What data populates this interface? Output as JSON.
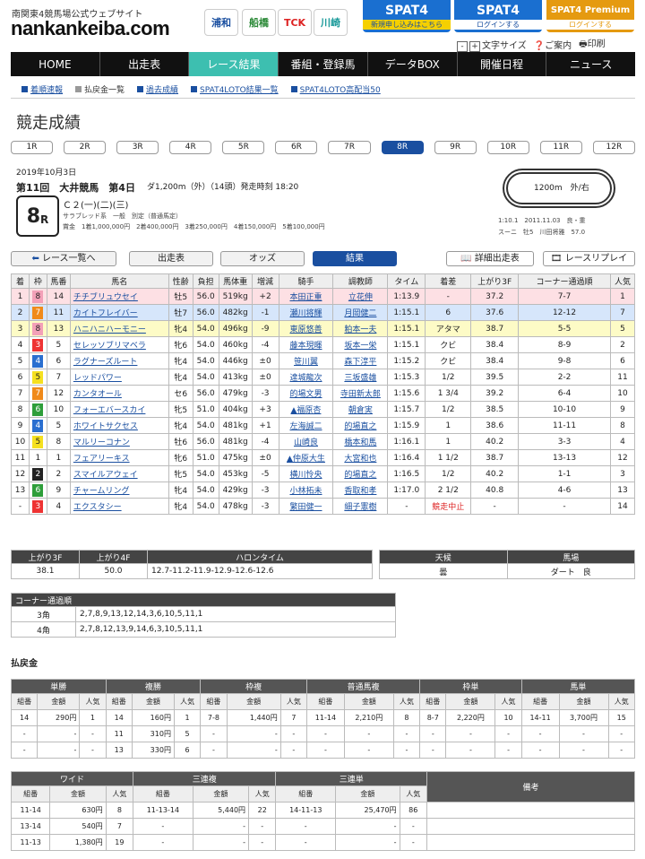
{
  "header": {
    "tagline": "南関東4競馬場公式ウェブサイト",
    "logo": "nankankeiba.com",
    "icons": [
      "浦和",
      "船橋",
      "TCK",
      "川崎"
    ],
    "banners": [
      {
        "big": "SPAT4",
        "sub": "新規申し込みはこちら",
        "color": "#1a6fd0"
      },
      {
        "big": "SPAT4",
        "sub": "ログインする",
        "color": "#1a6fd0"
      },
      {
        "big": "SPAT4 Premium",
        "sub": "ログインする",
        "color": "#e59a10"
      }
    ],
    "toolbar": {
      "font_size": "文字サイズ",
      "guide": "ご案内",
      "print": "印刷"
    }
  },
  "nav": [
    "HOME",
    "出走表",
    "レース結果",
    "番組・登録馬",
    "データBOX",
    "開催日程",
    "ニュース"
  ],
  "nav_active": 2,
  "subnav": [
    {
      "label": "着順速報",
      "link": true
    },
    {
      "label": "払戻金一覧",
      "link": false
    },
    {
      "label": "過去成績",
      "link": true
    },
    {
      "label": "SPAT4LOTO結果一覧",
      "link": true
    },
    {
      "label": "SPAT4LOTO高配当50",
      "link": true
    }
  ],
  "page_title": "競走成績",
  "race_tabs": [
    "1R",
    "2R",
    "3R",
    "4R",
    "5R",
    "6R",
    "7R",
    "8R",
    "9R",
    "10R",
    "11R",
    "12R"
  ],
  "race_active": 7,
  "race": {
    "date": "2019年10月3日",
    "kai": "第11回　大井競馬　第4日",
    "course": "ダ1,200m（外）（14頭）発走時刻 18:20",
    "num": "8",
    "num_suffix": "R",
    "class": "Ｃ２(一)(二)(三)",
    "cond": "サラブレッド系　一般　別定（普通馬定）",
    "prize": "賞金　1着1,000,000円　2着400,000円　3着250,000円　4着150,000円　5着100,000円",
    "track_label": "1200m　外/右",
    "record1": "1:10.1　2011.11.03　良・重",
    "record2": "スーニ　牡5　川田将雅　57.0"
  },
  "buttons": {
    "list": "レース一覧へ",
    "card": "出走表",
    "odds": "オッズ",
    "result": "結果",
    "detail": "詳細出走表",
    "replay": "レースリプレイ"
  },
  "result_headers": [
    "着",
    "枠",
    "馬番",
    "馬名",
    "性齢",
    "負担",
    "馬体重",
    "増減",
    "騎手",
    "調教師",
    "タイム",
    "着差",
    "上がり3F",
    "コーナー通過順",
    "人気"
  ],
  "results": [
    {
      "cls": "p1",
      "pos": "1",
      "waku": "8",
      "num": "14",
      "name": "チチブリュウセイ",
      "sa": "牡5",
      "wt": "56.0",
      "bw": "519kg",
      "diff": "+2",
      "jockey": "本田正重",
      "trainer": "立花伸",
      "time": "1:13.9",
      "margin": "-",
      "f3": "37.2",
      "corner": "7-7",
      "pop": "1"
    },
    {
      "cls": "p2",
      "pos": "2",
      "waku": "7",
      "num": "11",
      "name": "カイトフレイバー",
      "sa": "牡7",
      "wt": "56.0",
      "bw": "482kg",
      "diff": "-1",
      "jockey": "瀬川将輝",
      "trainer": "月岡健二",
      "time": "1:15.1",
      "margin": "6",
      "f3": "37.6",
      "corner": "12-12",
      "pop": "7"
    },
    {
      "cls": "p3",
      "pos": "3",
      "waku": "8",
      "num": "13",
      "name": "ハニハニハーモニー",
      "sa": "牝4",
      "wt": "54.0",
      "bw": "496kg",
      "diff": "-9",
      "jockey": "東原悠善",
      "trainer": "粕本一夫",
      "time": "1:15.1",
      "margin": "アタマ",
      "f3": "38.7",
      "corner": "5-5",
      "pop": "5"
    },
    {
      "cls": "",
      "pos": "4",
      "waku": "3",
      "num": "5",
      "name": "セレッソブリマベラ",
      "sa": "牝6",
      "wt": "54.0",
      "bw": "460kg",
      "diff": "-4",
      "jockey": "藤本現暉",
      "trainer": "坂本一栄",
      "time": "1:15.1",
      "margin": "クビ",
      "f3": "38.4",
      "corner": "8-9",
      "pop": "2"
    },
    {
      "cls": "",
      "pos": "5",
      "waku": "4",
      "num": "6",
      "name": "ラグナーズルート",
      "sa": "牝4",
      "wt": "54.0",
      "bw": "446kg",
      "diff": "±0",
      "jockey": "笹川翼",
      "trainer": "森下淳平",
      "time": "1:15.2",
      "margin": "クビ",
      "f3": "38.4",
      "corner": "9-8",
      "pop": "6"
    },
    {
      "cls": "",
      "pos": "6",
      "waku": "5",
      "num": "7",
      "name": "レッドパワー",
      "sa": "牝4",
      "wt": "54.0",
      "bw": "413kg",
      "diff": "±0",
      "jockey": "達城龍次",
      "trainer": "三坂盛雄",
      "time": "1:15.3",
      "margin": "1/2",
      "f3": "39.5",
      "corner": "2-2",
      "pop": "11"
    },
    {
      "cls": "",
      "pos": "7",
      "waku": "7",
      "num": "12",
      "name": "カンタオール",
      "sa": "セ6",
      "wt": "56.0",
      "bw": "479kg",
      "diff": "-3",
      "jockey": "的場文男",
      "trainer": "寺田新太郎",
      "time": "1:15.6",
      "margin": "1 3/4",
      "f3": "39.2",
      "corner": "6-4",
      "pop": "10"
    },
    {
      "cls": "",
      "pos": "8",
      "waku": "6",
      "num": "10",
      "name": "フォーエバースカイ",
      "sa": "牝5",
      "wt": "51.0",
      "bw": "404kg",
      "diff": "+3",
      "jockey": "▲福原杏",
      "trainer": "朝倉実",
      "time": "1:15.7",
      "margin": "1/2",
      "f3": "38.5",
      "corner": "10-10",
      "pop": "9"
    },
    {
      "cls": "",
      "pos": "9",
      "waku": "4",
      "num": "5",
      "name": "ホワイトサクセス",
      "sa": "牝4",
      "wt": "54.0",
      "bw": "481kg",
      "diff": "+1",
      "jockey": "左海誠二",
      "trainer": "的場直之",
      "time": "1:15.9",
      "margin": "1",
      "f3": "38.6",
      "corner": "11-11",
      "pop": "8"
    },
    {
      "cls": "",
      "pos": "10",
      "waku": "5",
      "num": "8",
      "name": "マルリーコナン",
      "sa": "牡6",
      "wt": "56.0",
      "bw": "481kg",
      "diff": "-4",
      "jockey": "山崎良",
      "trainer": "橋本和馬",
      "time": "1:16.1",
      "margin": "1",
      "f3": "40.2",
      "corner": "3-3",
      "pop": "4"
    },
    {
      "cls": "",
      "pos": "11",
      "waku": "1",
      "num": "1",
      "name": "フェアリーキス",
      "sa": "牝6",
      "wt": "51.0",
      "bw": "475kg",
      "diff": "±0",
      "jockey": "▲仲原大生",
      "trainer": "大宮和也",
      "time": "1:16.4",
      "margin": "1 1/2",
      "f3": "38.7",
      "corner": "13-13",
      "pop": "12"
    },
    {
      "cls": "",
      "pos": "12",
      "waku": "2",
      "num": "2",
      "name": "スマイルアウェイ",
      "sa": "牝5",
      "wt": "54.0",
      "bw": "453kg",
      "diff": "-5",
      "jockey": "横川怜央",
      "trainer": "的場直之",
      "time": "1:16.5",
      "margin": "1/2",
      "f3": "40.2",
      "corner": "1-1",
      "pop": "3"
    },
    {
      "cls": "",
      "pos": "13",
      "waku": "6",
      "num": "9",
      "name": "チャームリング",
      "sa": "牝4",
      "wt": "54.0",
      "bw": "429kg",
      "diff": "-3",
      "jockey": "小林拓未",
      "trainer": "香取和孝",
      "time": "1:17.0",
      "margin": "2 1/2",
      "f3": "40.8",
      "corner": "4-6",
      "pop": "13"
    },
    {
      "cls": "",
      "pos": "-",
      "waku": "3",
      "num": "4",
      "name": "エクスタシー",
      "sa": "牝4",
      "wt": "54.0",
      "bw": "478kg",
      "diff": "-3",
      "jockey": "繁田健一",
      "trainer": "細子憲樹",
      "time": "-",
      "margin": "競走中止",
      "f3": "-",
      "corner": "-",
      "pop": "14"
    }
  ],
  "stats": {
    "headers": [
      "上がり3F",
      "上がり4F",
      "ハロンタイム"
    ],
    "f3": "38.1",
    "f4": "50.0",
    "halon": "12.7-11.2-11.9-12.9-12.6-12.6"
  },
  "weather": {
    "headers": [
      "天候",
      "馬場"
    ],
    "weather": "曇",
    "track": "ダート　良"
  },
  "corner": {
    "title": "コーナー通過順",
    "rows": [
      {
        "label": "3角",
        "value": "2,7,8,9,13,12,14,3,6,10,5,11,1"
      },
      {
        "label": "4角",
        "value": "2,7,8,12,13,9,14,6,3,10,5,11,1"
      }
    ]
  },
  "payout_title": "払戻金",
  "payout1": {
    "groups": [
      "単勝",
      "複勝",
      "枠複",
      "普通馬複",
      "枠単",
      "馬単"
    ],
    "sub": [
      "組番",
      "金額",
      "人気"
    ],
    "rows": [
      [
        "14",
        "290円",
        "1",
        "14",
        "160円",
        "1",
        "7-8",
        "1,440円",
        "7",
        "11-14",
        "2,210円",
        "8",
        "8-7",
        "2,220円",
        "10",
        "14-11",
        "3,700円",
        "15"
      ],
      [
        "-",
        "-",
        "-",
        "11",
        "310円",
        "5",
        "-",
        "-",
        "-",
        "-",
        "-",
        "-",
        "-",
        "-",
        "-",
        "-",
        "-",
        "-"
      ],
      [
        "-",
        "-",
        "-",
        "13",
        "330円",
        "6",
        "-",
        "-",
        "-",
        "-",
        "-",
        "-",
        "-",
        "-",
        "-",
        "-",
        "-",
        "-"
      ]
    ]
  },
  "payout2": {
    "groups": [
      "ワイド",
      "三連複",
      "三連単",
      "備考"
    ],
    "sub": [
      "組番",
      "金額",
      "人気"
    ],
    "rows": [
      [
        "11-14",
        "630円",
        "8",
        "11-13-14",
        "5,440円",
        "22",
        "14-11-13",
        "25,470円",
        "86",
        ""
      ],
      [
        "13-14",
        "540円",
        "7",
        "-",
        "-",
        "-",
        "-",
        "-",
        "-",
        ""
      ],
      [
        "11-13",
        "1,380円",
        "19",
        "-",
        "-",
        "-",
        "-",
        "-",
        "-",
        ""
      ]
    ]
  }
}
